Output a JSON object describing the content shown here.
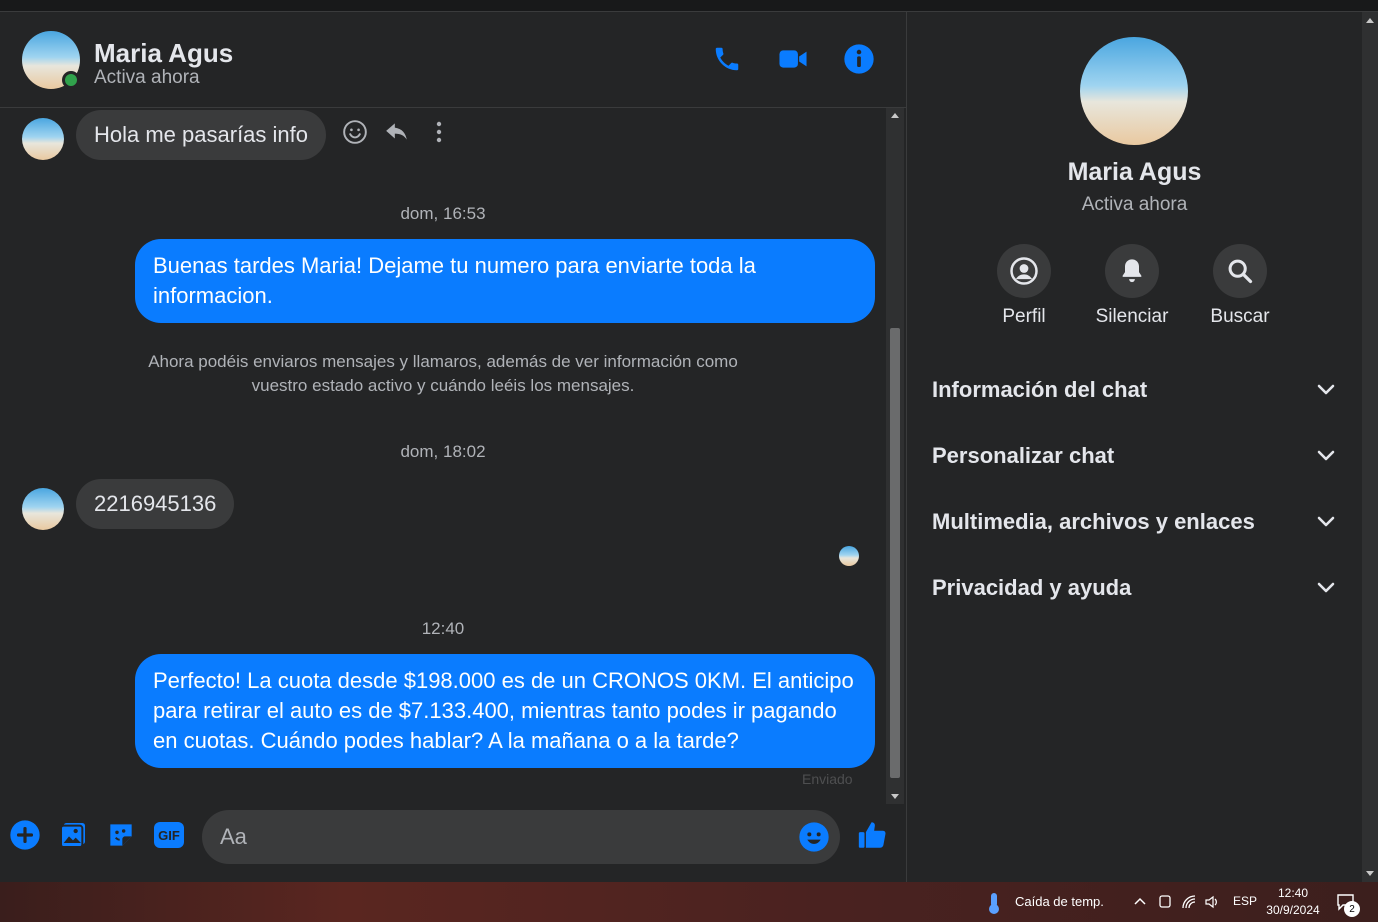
{
  "header": {
    "name": "Maria Agus",
    "status": "Activa ahora",
    "icons": [
      "phone-icon",
      "video-camera-icon",
      "info-icon"
    ]
  },
  "messages": {
    "incoming_1": "Hola me pasarías info",
    "timestamp_1": "dom, 16:53",
    "outgoing_1": "Buenas tardes Maria! Dejame tu numero para enviarte toda la informacion.",
    "system_note": "Ahora podéis enviaros mensajes y llamaros, además de ver información como vuestro estado activo y cuándo leéis los mensajes.",
    "timestamp_2": "dom, 18:02",
    "incoming_2": "2216945136",
    "timestamp_3": "12:40",
    "outgoing_2": "Perfecto! La cuota desde $198.000 es de un CRONOS 0KM. El anticipo para retirar el auto es de $7.133.400, mientras tanto podes ir pagando en cuotas. Cuándo podes hablar? A la mañana o a la tarde?",
    "sent_status": "Enviado"
  },
  "composer": {
    "placeholder": "Aa",
    "icons": [
      "plus-icon",
      "image-icon",
      "sticker-icon",
      "gif-icon",
      "emoji-icon",
      "thumbs-up-icon"
    ],
    "gif_label": "GIF"
  },
  "info_panel": {
    "name": "Maria Agus",
    "status": "Activa ahora",
    "actions": [
      {
        "label": "Perfil",
        "icon": "profile-icon"
      },
      {
        "label": "Silenciar",
        "icon": "bell-icon"
      },
      {
        "label": "Buscar",
        "icon": "search-icon"
      }
    ],
    "sections": [
      {
        "label": "Información del chat"
      },
      {
        "label": "Personalizar chat"
      },
      {
        "label": "Multimedia, archivos y enlaces"
      },
      {
        "label": "Privacidad y ayuda"
      }
    ]
  },
  "taskbar": {
    "weather": "Caída de temp.",
    "language": "ESP",
    "time": "12:40",
    "date": "30/9/2024",
    "notifications": "2"
  },
  "colors": {
    "accent": "#0a7cff",
    "background": "#242526",
    "bubble_in": "#3a3b3c",
    "online": "#31a24c"
  }
}
